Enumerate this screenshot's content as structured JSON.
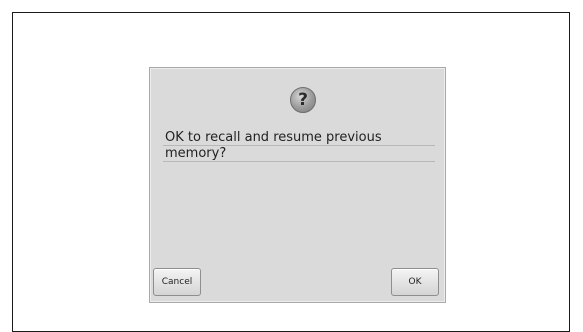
{
  "dialog": {
    "icon": "question-mark-icon",
    "icon_glyph": "?",
    "message_lines": [
      "OK to recall and resume previous",
      "memory?"
    ],
    "buttons": {
      "cancel_label": "Cancel",
      "ok_label": "OK"
    }
  },
  "colors": {
    "dialog_bg": "#dadada",
    "frame_border": "#1a1a1a",
    "text": "#222222"
  }
}
